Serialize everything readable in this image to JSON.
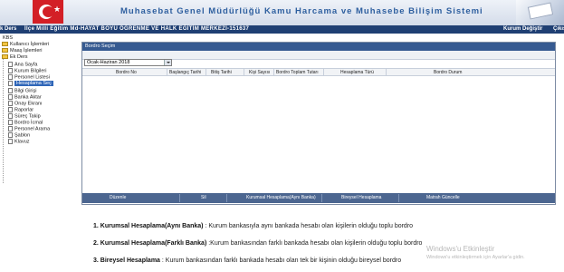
{
  "header": {
    "title": "Muhasebat Genel Müdürlüğü Kamu Harcama ve Muhasebe Bilişim Sistemi",
    "flag_star": "★"
  },
  "infobar": {
    "left_text": "k Ders",
    "school": "İlçe Milli Eğitim Md-HAYAT BOYU ÖĞRENME VE HALK EĞİTİM MERKEZİ-151637",
    "kurum_degistir": "Kurum Değiştir",
    "cikis": "Çıkış"
  },
  "sidebar": {
    "root": "KBS",
    "folders": [
      "Kullanıcı İşlemleri",
      "Maaş İşlemleri",
      "Ek Ders"
    ],
    "items": [
      "Ana Sayfa",
      "Kurum Bilgileri",
      "Personel Listesi",
      "Hesaplama Seç",
      "Bilgi Girişi",
      "Banka Aktar",
      "Onay Ekranı",
      "Raporlar",
      "Süreç Takip",
      "Bordro İcmal",
      "Personel Arama",
      "Şablon",
      "Klavuz"
    ],
    "selected_index": 3
  },
  "panel": {
    "title": "Bordro Seçim",
    "period_select": "Ocak-Haziran 2018",
    "columns": [
      "Bordro No",
      "Başlangıç Tarihi",
      "Bitiş Tarihi",
      "Kişi Sayısı",
      "Bordro Toplam Tutarı",
      "Hesaplama Türü",
      "Bordro Durum"
    ],
    "footer_buttons": [
      "Düzenle",
      "Sil",
      "Kurumsal Hesaplama(Aynı Banka)",
      "Bireysel Hesaplama",
      "Matrah Güncelle"
    ]
  },
  "descriptions": [
    {
      "label": "1. Kurumsal Hesaplama(Aynı Banka)",
      "text": " : Kurum bankasıyla aynı bankada hesabı olan kişilerin olduğu toplu bordro"
    },
    {
      "label": "2. Kurumsal Hesaplama(Farklı Banka)",
      "text": " :Kurum bankasından farklı bankada hesabı olan kişilerin olduğu toplu bordro"
    },
    {
      "label": "3. Bireysel Hesaplama",
      "text": " : Kurum bankasından farklı bankada hesabı olan tek bir kişinin olduğu bireysel bordro"
    }
  ],
  "watermark": {
    "line1": "Windows'u Etkinleştir",
    "line2": "Windows'u etkinleştirmek için Ayarlar'a gidin."
  }
}
